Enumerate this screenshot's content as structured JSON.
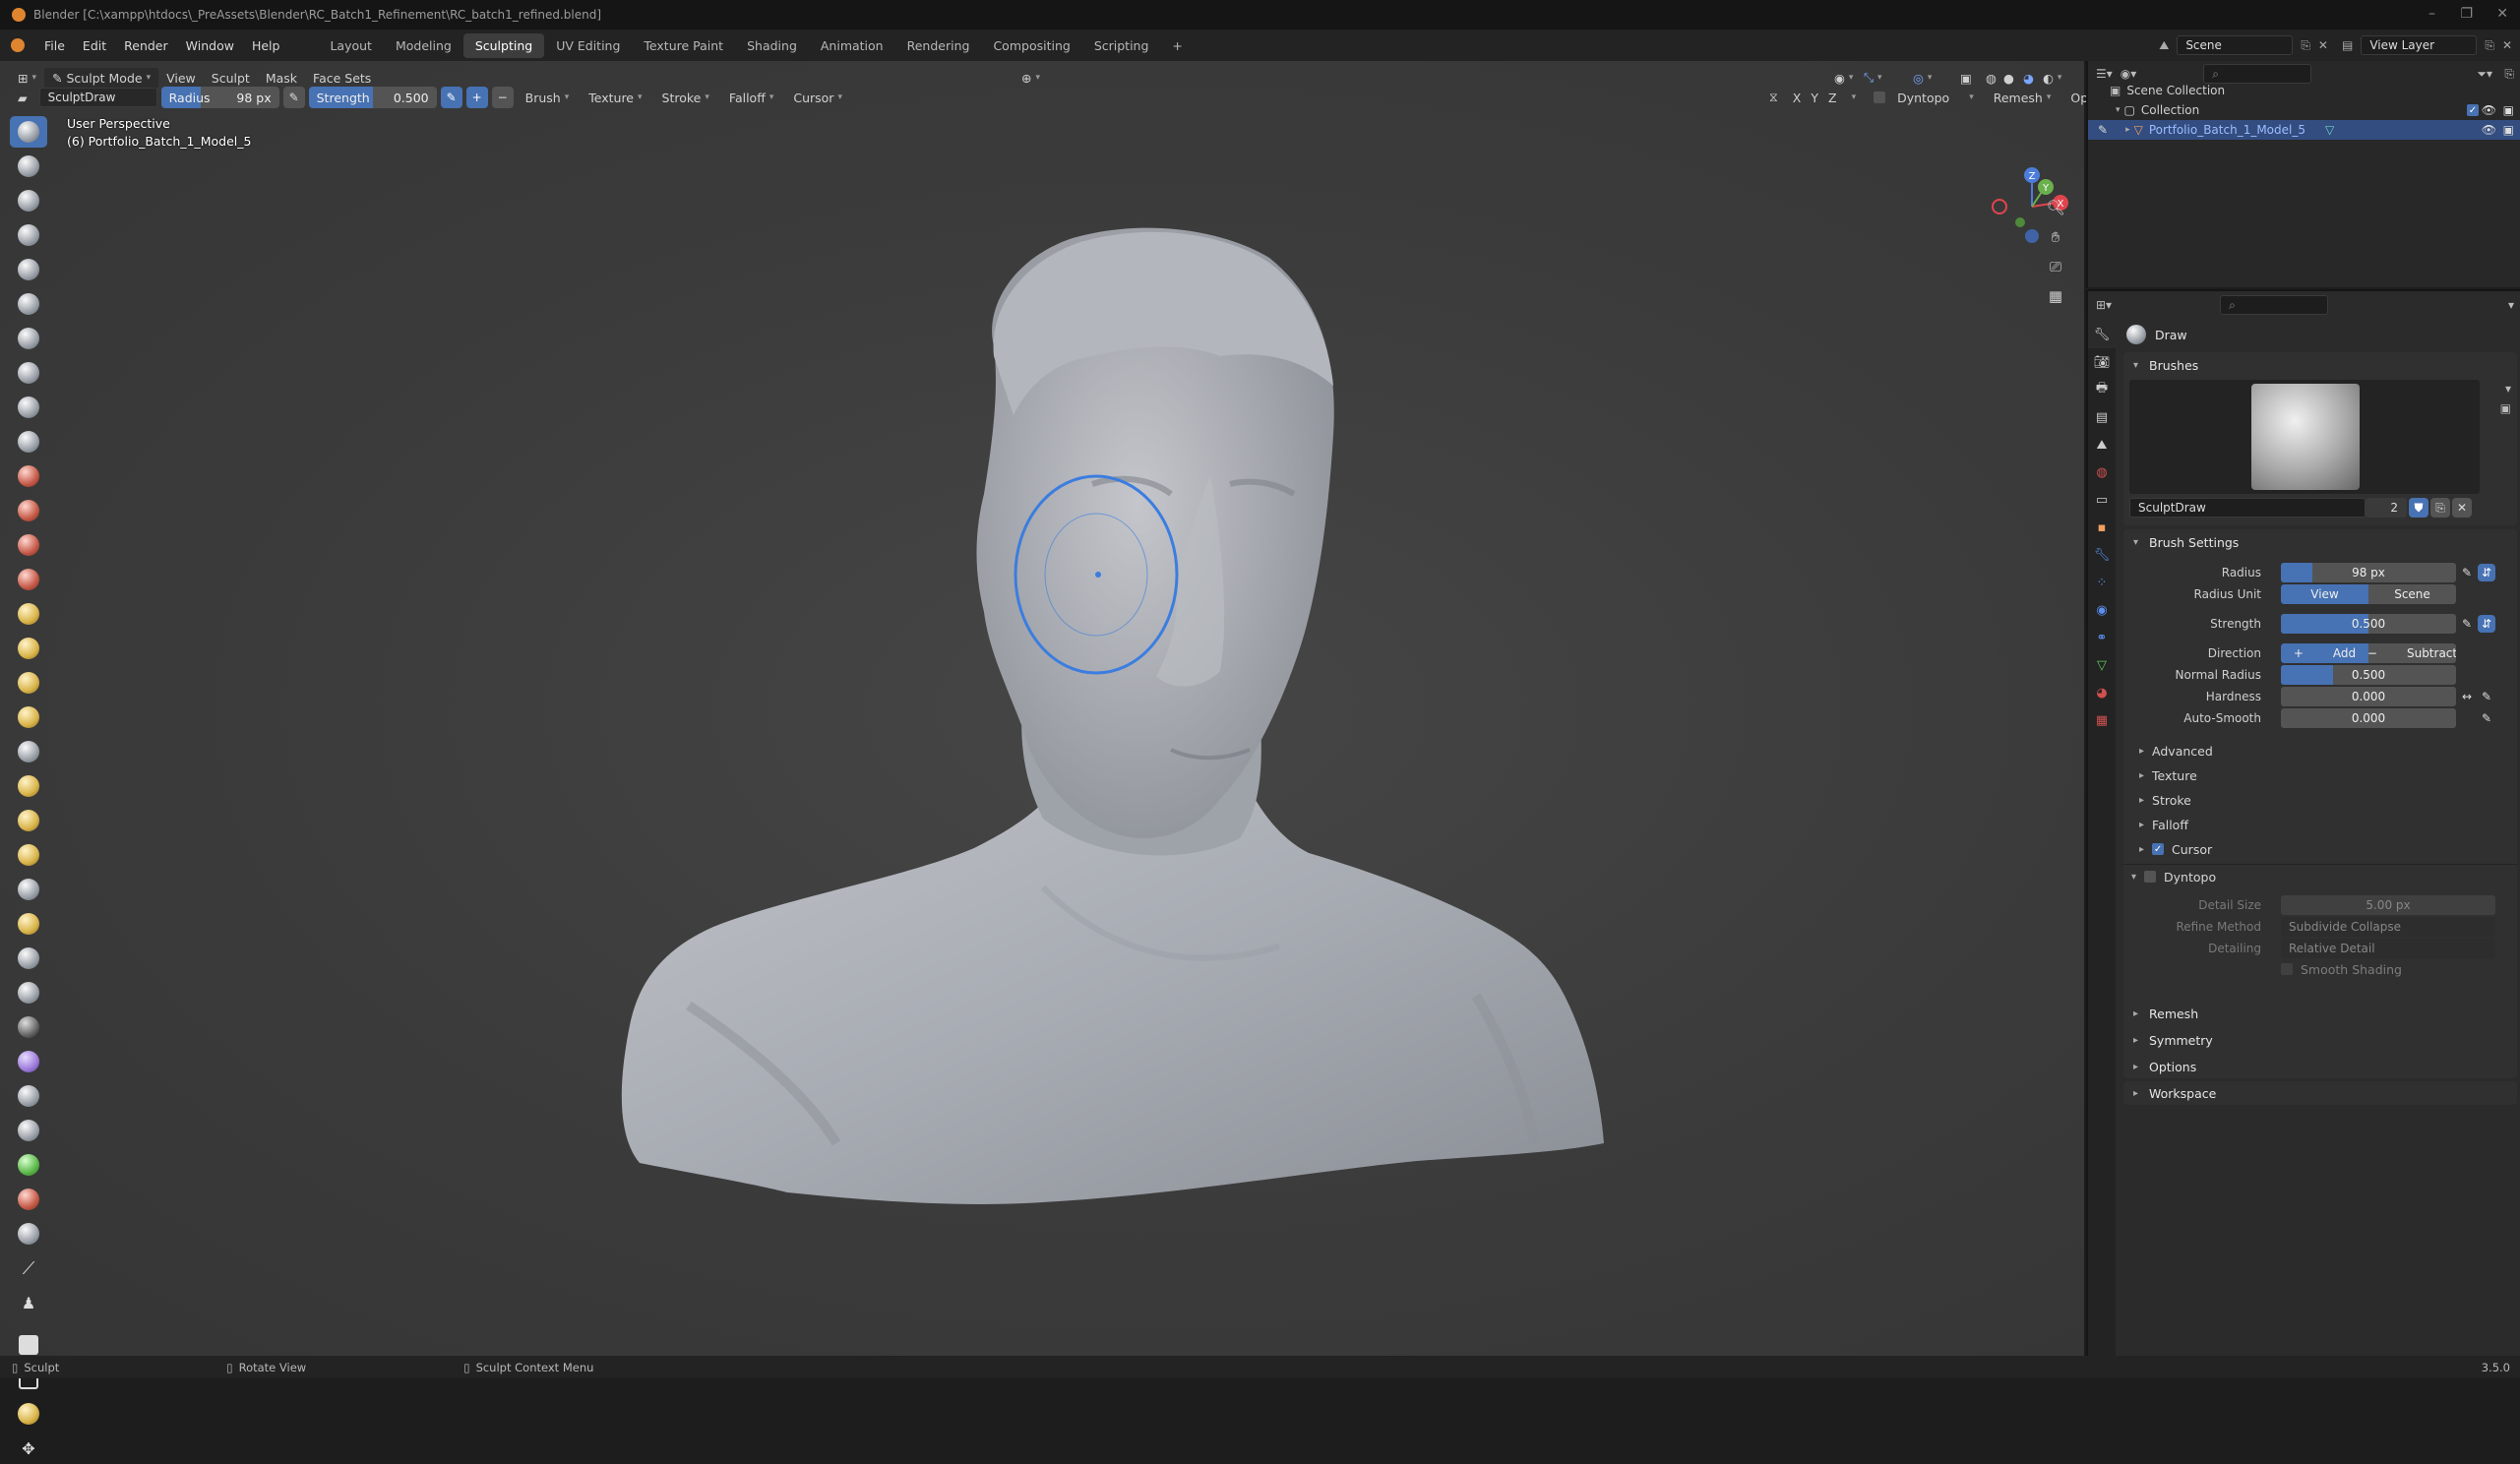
{
  "titlebar": {
    "title": "Blender [C:\\xampp\\htdocs\\_PreAssets\\Blender\\RC_Batch1_Refinement\\RC_batch1_refined.blend]"
  },
  "menubar": {
    "menus": [
      "File",
      "Edit",
      "Render",
      "Window",
      "Help"
    ],
    "workspaces": [
      "Layout",
      "Modeling",
      "Sculpting",
      "UV Editing",
      "Texture Paint",
      "Shading",
      "Animation",
      "Rendering",
      "Compositing",
      "Scripting"
    ],
    "active_workspace": "Sculpting",
    "add_tab": "+",
    "scene_label": "Scene",
    "view_layer_label": "View Layer"
  },
  "viewport_header": {
    "mode": "Sculpt Mode",
    "menus": [
      "View",
      "Sculpt",
      "Mask",
      "Face Sets"
    ],
    "axes": [
      "X",
      "Y",
      "Z"
    ],
    "dyntopo": "Dyntopo",
    "remesh": "Remesh",
    "options": "Options"
  },
  "tool_header": {
    "brush_name": "SculptDraw",
    "radius_label": "Radius",
    "radius_value": "98 px",
    "strength_label": "Strength",
    "strength_value": "0.500",
    "strength_fraction": 0.5,
    "add_symbol": "+",
    "sub_symbol": "−",
    "dropdowns": [
      "Brush",
      "Texture",
      "Stroke",
      "Falloff",
      "Cursor"
    ]
  },
  "overlay": {
    "view_name": "User Perspective",
    "object_name": "(6) Portfolio_Batch_1_Model_5"
  },
  "gizmo": {
    "z": "Z",
    "y": "Y",
    "x": "X"
  },
  "outliner": {
    "scene_collection": "Scene Collection",
    "collection": "Collection",
    "object": "Portfolio_Batch_1_Model_5"
  },
  "properties": {
    "tool_name": "Draw",
    "brushes_header": "Brushes",
    "brush_name": "SculptDraw",
    "brush_users": "2",
    "brush_settings_header": "Brush Settings",
    "rows": {
      "radius": {
        "label": "Radius",
        "value": "98 px",
        "fraction": 0.18
      },
      "radius_unit": {
        "label": "Radius Unit",
        "option_a": "View",
        "option_b": "Scene"
      },
      "strength": {
        "label": "Strength",
        "value": "0.500",
        "fraction": 0.5
      },
      "direction": {
        "label": "Direction",
        "option_a": "Add",
        "option_b": "Subtract"
      },
      "normal_radius": {
        "label": "Normal Radius",
        "value": "0.500",
        "fraction": 0.3
      },
      "hardness": {
        "label": "Hardness",
        "value": "0.000"
      },
      "auto_smooth": {
        "label": "Auto-Smooth",
        "value": "0.000"
      }
    },
    "subpanels": [
      "Advanced",
      "Texture",
      "Stroke",
      "Falloff",
      "Cursor"
    ],
    "dyntopo": {
      "header": "Dyntopo",
      "detail_size_label": "Detail Size",
      "detail_size_value": "5.00 px",
      "refine_method_label": "Refine Method",
      "refine_method_value": "Subdivide Collapse",
      "detailing_label": "Detailing",
      "detailing_value": "Relative Detail",
      "smooth_shading": "Smooth Shading"
    },
    "bottom_panels": [
      "Remesh",
      "Symmetry",
      "Options",
      "Workspace"
    ]
  },
  "statusbar": {
    "left": "Sculpt",
    "middle": "Rotate View",
    "right": "Sculpt Context Menu",
    "version": "3.5.0"
  },
  "colors": {
    "accent": "#4772b3",
    "header_bg": "#232323",
    "viewport_bg": "#3d3d3d",
    "brush_circle": "#3b7de0",
    "mesh": "#a9adb4"
  }
}
